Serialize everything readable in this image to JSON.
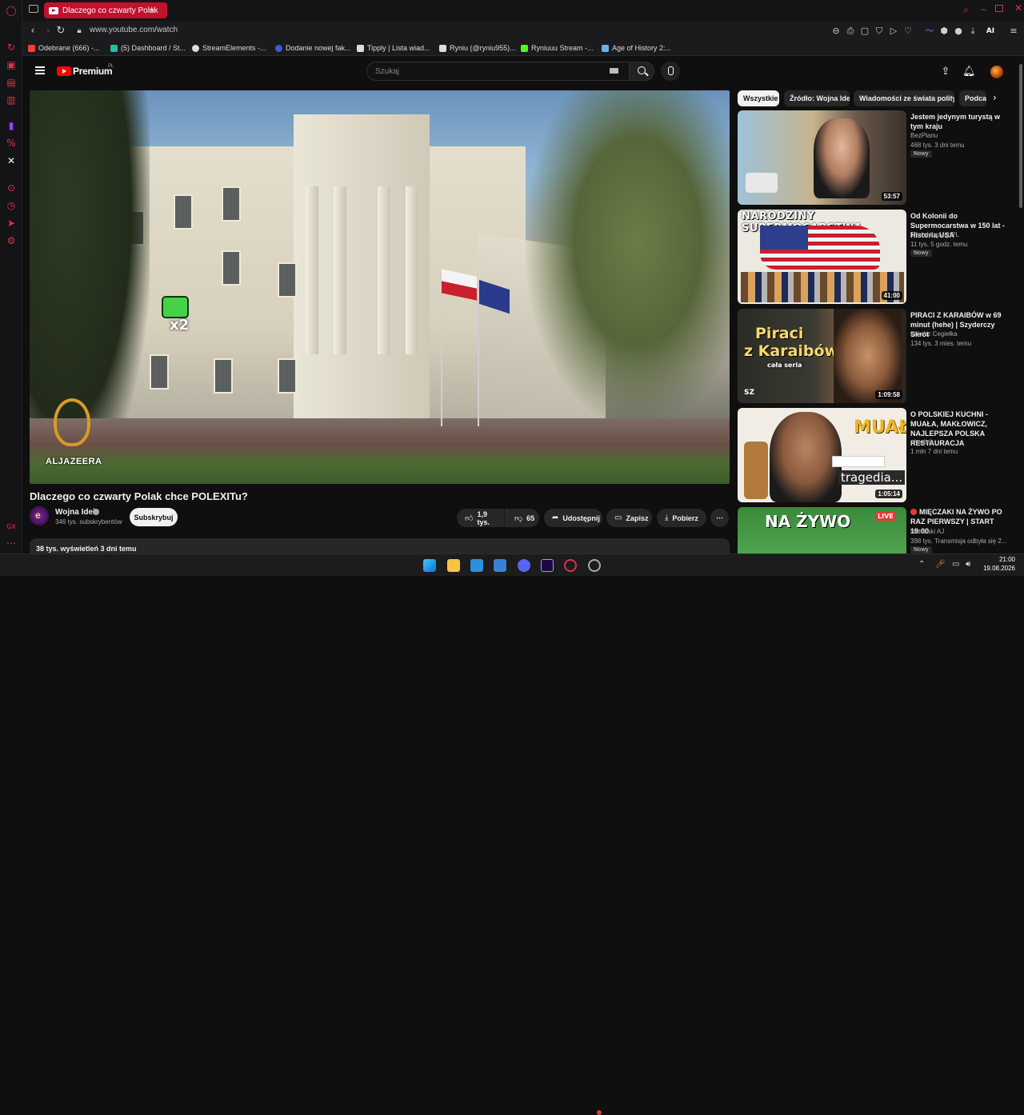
{
  "browser": {
    "tab_title": "Dlaczego co czwarty Polak",
    "new_tab": "+",
    "url": "www.youtube.com/watch",
    "toolbar_ai": "AI",
    "bookmarks": [
      {
        "label": "Odebrane (666) -...",
        "color": "#ea4335"
      },
      {
        "label": "(5) Dashboard / St...",
        "color": "#1ec1a4"
      },
      {
        "label": "StreamElements -...",
        "color": "#dddddd"
      },
      {
        "label": "Dodanie nowej fak...",
        "color": "#3b5bd9"
      },
      {
        "label": "Tipply | Lista wiad...",
        "color": "#dddddd"
      },
      {
        "label": "Ryniu (@ryniu955)...",
        "color": "#dddddd"
      },
      {
        "label": "Ryniuuu Stream -...",
        "color": "#53fc18"
      },
      {
        "label": "Age of History 2:...",
        "color": "#6ab0e8"
      }
    ],
    "sidebar_icons": [
      "opera-icon",
      "history-icon",
      "bag-icon",
      "news-icon",
      "clipboard-icon",
      "twitch-icon",
      "percent-icon",
      "x-icon",
      "player-icon",
      "clock-icon",
      "send-icon",
      "settings-icon",
      "gx-icon",
      "more-icon"
    ],
    "sidebar_bottom_label": "GX"
  },
  "youtube": {
    "logo_text": "Premium",
    "region": "PL",
    "search_placeholder": "Szukaj",
    "video": {
      "title": "Dlaczego co czwarty Polak chce POLEXITu?",
      "watermark": "ALJAZEERA",
      "overlay_badge": "x2"
    },
    "channel": {
      "name": "Wojna Idei",
      "subscribers": "346 tys. subskrybentów",
      "subscribe_label": "Subskrybuj"
    },
    "actions": {
      "likes": "1,9 tys.",
      "dislikes": "65",
      "share": "Udostępnij",
      "save": "Zapisz",
      "download": "Pobierz"
    },
    "description_summary": "38 tys. wyświetleń  3 dni temu",
    "chips": [
      "Wszystkie",
      "Źródło: Wojna Idei",
      "Wiadomości ze świata polityki",
      "Podcasty"
    ],
    "related": [
      {
        "title": "Jestem jedynym turystą w tym kraju",
        "channel": "BezPlanu",
        "meta": "468 tys.  3 dni temu",
        "badge": "Nowy",
        "duration": "53:57"
      },
      {
        "title": "Od Kolonii do Supermocarstwa w 150 lat - Historia USA",
        "channel": "ThrashingMadPL",
        "meta": "11 tys.  5 godz. temu",
        "badge": "Nowy",
        "duration": "41:00",
        "thumb_text": "NARODZINY SUPERMOCARSTWA"
      },
      {
        "title": "PIRACI Z KARAIBÓW w 69 minut (hehe) | Szyderczy Skrót",
        "channel": "Łukasz Cegiełka",
        "meta": "134 tys.  3 mies. temu",
        "badge": "",
        "duration": "1:09:58",
        "thumb_text_1": "Piraci",
        "thumb_text_2": "z Karaibów",
        "thumb_text_3": "cała seria",
        "thumb_corner": "SZ"
      },
      {
        "title": "O POLSKIEJ KUCHNI - MUAŁA, MAKŁOWICZ, NAJLEPSZA POLSKA RESTAURACJA",
        "channel": "ojwojtek",
        "meta": "1 mln  7 dni temu",
        "badge": "",
        "duration": "1:05:14",
        "thumb_text_1": "MUAŁA",
        "thumb_text_2": "tragedia..."
      },
      {
        "title": "MIĘCZAKI NA ŻYWO PO RAZ PIERWSZY | START 19:00",
        "channel": "Mieczaki AJ",
        "meta": "398 tys.  Transmisja odbyła się 2...",
        "badge": "Nowy",
        "duration": "",
        "thumb_text_1": "NA ŻYWO",
        "thumb_live": "LIVE"
      }
    ]
  },
  "taskbar": {
    "time": "21:00",
    "date": "19.08.2026"
  }
}
